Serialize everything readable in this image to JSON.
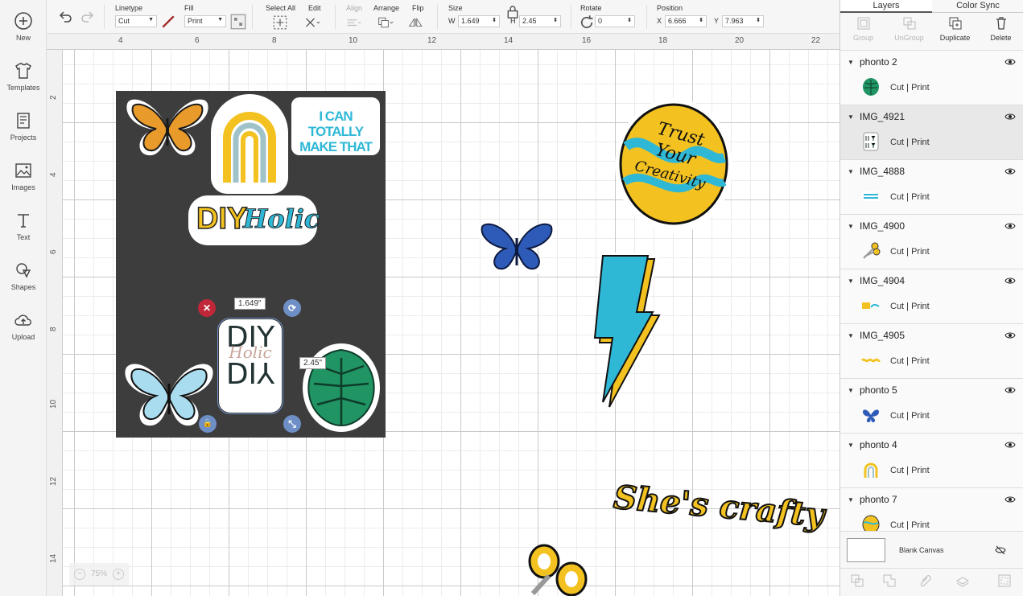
{
  "sidebar": {
    "items": [
      {
        "label": "New",
        "icon": "plus-circle-icon"
      },
      {
        "label": "Templates",
        "icon": "tshirt-icon"
      },
      {
        "label": "Projects",
        "icon": "projects-icon"
      },
      {
        "label": "Images",
        "icon": "image-icon"
      },
      {
        "label": "Text",
        "icon": "text-icon"
      },
      {
        "label": "Shapes",
        "icon": "shapes-icon"
      },
      {
        "label": "Upload",
        "icon": "upload-cloud-icon"
      }
    ]
  },
  "toolbar": {
    "linetype_label": "Linetype",
    "linetype_value": "Cut",
    "fill_label": "Fill",
    "fill_value": "Print",
    "select_all_label": "Select All",
    "edit_label": "Edit",
    "align_label": "Align",
    "arrange_label": "Arrange",
    "flip_label": "Flip",
    "size_label": "Size",
    "w_label": "W",
    "w_value": "1.649",
    "h_label": "H",
    "h_value": "2.45",
    "rotate_label": "Rotate",
    "rotate_value": "0",
    "position_label": "Position",
    "x_label": "X",
    "x_value": "6.666",
    "y_label": "Y",
    "y_value": "7.963"
  },
  "ruler": {
    "top": [
      "4",
      "6",
      "8",
      "10",
      "12",
      "14",
      "16",
      "18",
      "20",
      "22"
    ],
    "left": [
      "2",
      "4",
      "6",
      "8",
      "10",
      "12",
      "14"
    ]
  },
  "canvas": {
    "size_badge_w": "1.649\"",
    "size_badge_h": "2.45\"",
    "zoom": "75%",
    "stickers": {
      "can_totally": [
        "I CAN TOTALLY",
        "MAKE THAT"
      ],
      "diy": "DIY",
      "holic": "Holic",
      "trust": [
        "Trust",
        "Your",
        "Creativity"
      ],
      "shes_crafty": "She's crafty",
      "box_top": "DIY",
      "box_mid": "Holic",
      "box_bottom": "DIY"
    }
  },
  "right_panel": {
    "tabs": [
      "Layers",
      "Color Sync"
    ],
    "actions": [
      {
        "label": "Group",
        "enabled": false
      },
      {
        "label": "UnGroup",
        "enabled": false
      },
      {
        "label": "Duplicate",
        "enabled": true
      },
      {
        "label": "Delete",
        "enabled": true
      }
    ],
    "layers": [
      {
        "name": "phonto 2",
        "ops": "Cut  | Print",
        "thumb": "leaf"
      },
      {
        "name": "IMG_4921",
        "ops": "Cut  | Print",
        "thumb": "diy-box"
      },
      {
        "name": "IMG_4888",
        "ops": "Cut  | Print",
        "thumb": "text-sticker"
      },
      {
        "name": "IMG_4900",
        "ops": "Cut  | Print",
        "thumb": "scissors"
      },
      {
        "name": "IMG_4904",
        "ops": "Cut  | Print",
        "thumb": "diy-holic"
      },
      {
        "name": "IMG_4905",
        "ops": "Cut  | Print",
        "thumb": "shes-crafty"
      },
      {
        "name": "phonto 5",
        "ops": "Cut  | Print",
        "thumb": "butterfly-blue"
      },
      {
        "name": "phonto 4",
        "ops": "Cut  | Print",
        "thumb": "rainbow"
      },
      {
        "name": "phonto 7",
        "ops": "Cut  | Print",
        "thumb": "trust-circle"
      }
    ],
    "blank_canvas_label": "Blank Canvas",
    "bottom_actions": [
      "Slice",
      "Weld",
      "Attach",
      "Flatten",
      "Contour"
    ]
  },
  "colors": {
    "sheet": "#3d3d3d",
    "teal": "#2fb8d6",
    "yellow": "#f3c220",
    "delete_handle": "#c0283a",
    "handle_blue": "#6e8fc6"
  }
}
